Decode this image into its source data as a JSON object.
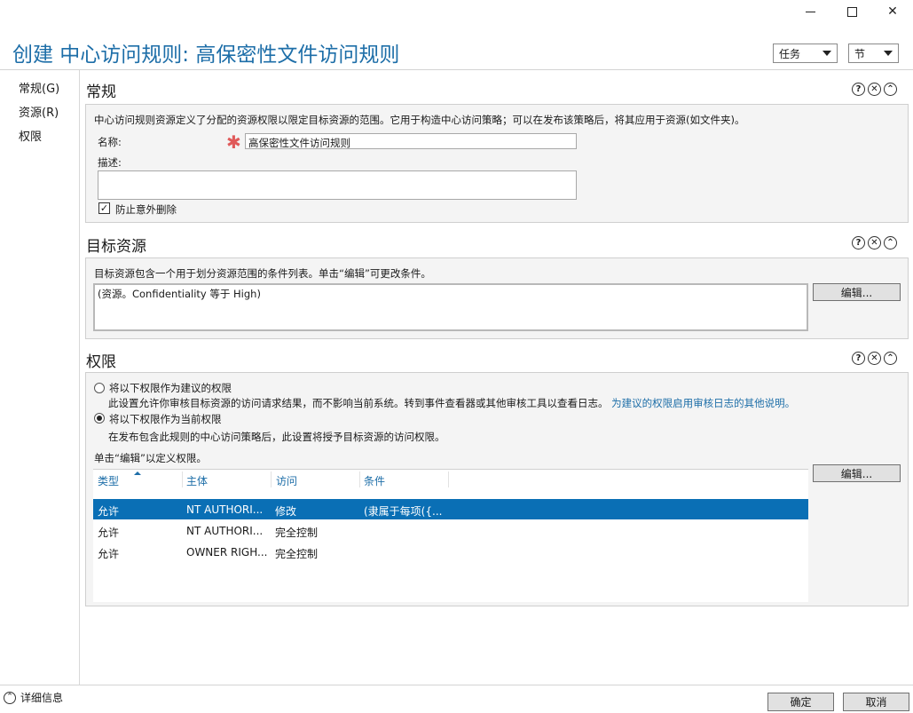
{
  "window": {
    "title": "创建 中心访问规则: 高保密性文件访问规则",
    "minimize": "—",
    "close": "✕",
    "tasks_label": "任务",
    "section_label": "节"
  },
  "sidebar": {
    "items": [
      {
        "label": "常规(G)"
      },
      {
        "label": "资源(R)"
      },
      {
        "label": "权限"
      }
    ]
  },
  "general": {
    "title": "常规",
    "description": "中心访问规则资源定义了分配的资源权限以限定目标资源的范围。它用于构造中心访问策略；可以在发布该策略后，将其应用于资源(如文件夹)。",
    "name_label": "名称:",
    "required_mark": "✱",
    "name_value": "高保密性文件访问规则",
    "desc_label": "描述:",
    "desc_value": "",
    "protect_label": "防止意外删除",
    "protect_checked": true
  },
  "target": {
    "title": "目标资源",
    "description": "目标资源包含一个用于划分资源范围的条件列表。单击“编辑”可更改条件。",
    "condition": "(资源。Confidentiality 等于 High)",
    "edit_label": "编辑..."
  },
  "permissions": {
    "title": "权限",
    "option1_label": "将以下权限作为建议的权限",
    "option1_desc": "此设置允许你审核目标资源的访问请求结果，而不影响当前系统。转到事件查看器或其他审核工具以查看日志。",
    "option1_link": "为建议的权限启用审核日志的其他说明。",
    "option2_label": "将以下权限作为当前权限",
    "option2_desc": "在发布包含此规则的中心访问策略后，此设置将授予目标资源的访问权限。",
    "selected_option": 2,
    "edit_hint": "单击“编辑”以定义权限。",
    "edit_label": "编辑...",
    "columns": [
      "类型",
      "主体",
      "访问",
      "条件"
    ],
    "rows": [
      {
        "type": "允许",
        "principal": "NT AUTHORI...",
        "access": "修改",
        "condition": "(隶属于每项({...",
        "selected": true
      },
      {
        "type": "允许",
        "principal": "NT AUTHORI...",
        "access": "完全控制",
        "condition": "",
        "selected": false
      },
      {
        "type": "允许",
        "principal": "OWNER RIGH...",
        "access": "完全控制",
        "condition": "",
        "selected": false
      }
    ]
  },
  "section_icons": {
    "help": "?",
    "close": "✕",
    "collapse": "⌃"
  },
  "footer": {
    "details_label": "详细信息",
    "ok_label": "确定",
    "cancel_label": "取消"
  },
  "colors": {
    "accent": "#1d6ea8",
    "selection": "#0a6fb5",
    "panel": "#f4f4f4"
  }
}
